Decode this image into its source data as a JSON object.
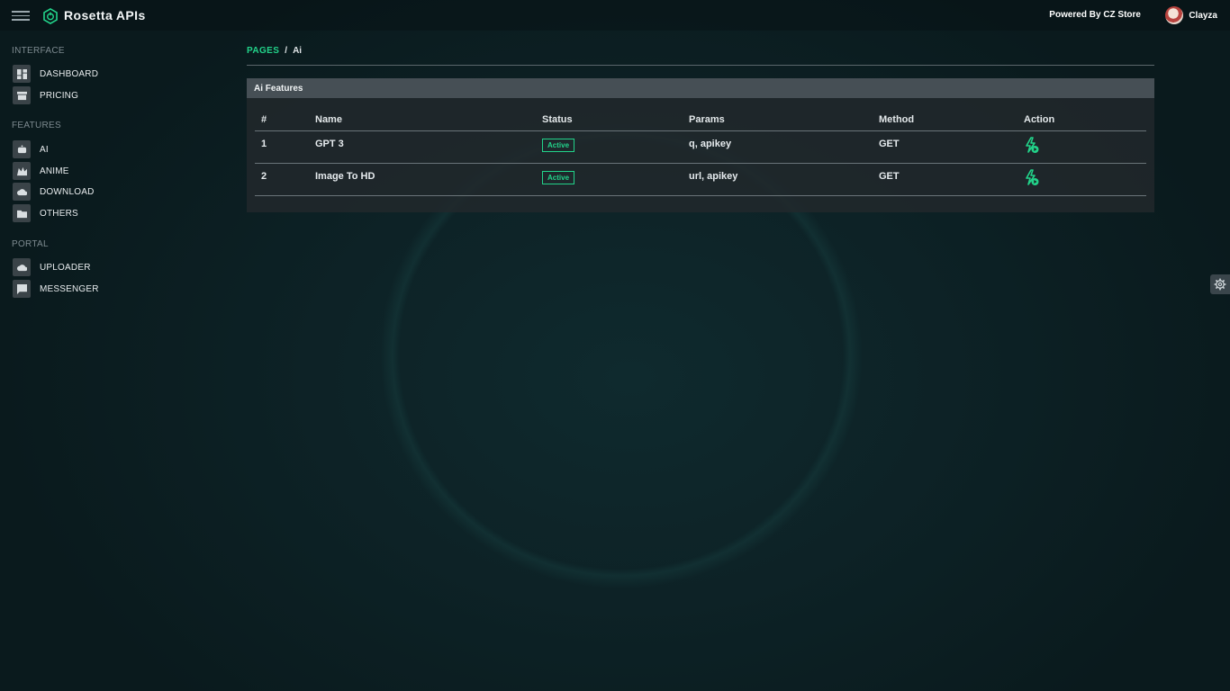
{
  "header": {
    "brand_title": "Rosetta APIs",
    "powered_by": "Powered By CZ Store",
    "user_name": "Clayza",
    "accent_color": "#22d38a"
  },
  "sidebar": {
    "sections": [
      {
        "title": "INTERFACE",
        "items": [
          {
            "label": "DASHBOARD",
            "icon": "dashboard-icon"
          },
          {
            "label": "PRICING",
            "icon": "store-icon"
          }
        ]
      },
      {
        "title": "FEATURES",
        "items": [
          {
            "label": "AI",
            "icon": "robot-icon"
          },
          {
            "label": "ANIME",
            "icon": "anime-icon"
          },
          {
            "label": "DOWNLOAD",
            "icon": "cloud-download-icon"
          },
          {
            "label": "OTHERS",
            "icon": "folder-icon"
          }
        ]
      },
      {
        "title": "PORTAL",
        "items": [
          {
            "label": "UPLOADER",
            "icon": "cloud-upload-icon"
          },
          {
            "label": "MESSENGER",
            "icon": "chat-icon"
          }
        ]
      }
    ]
  },
  "breadcrumb": {
    "parent": "PAGES",
    "separator": "/",
    "current": "Ai"
  },
  "card": {
    "title": "Ai Features",
    "columns": [
      "#",
      "Name",
      "Status",
      "Params",
      "Method",
      "Action"
    ],
    "rows": [
      {
        "num": "1",
        "name": "GPT 3",
        "status": "Active",
        "params": "q, apikey",
        "method": "GET",
        "action_icon": "run-api-icon"
      },
      {
        "num": "2",
        "name": "Image To HD",
        "status": "Active",
        "params": "url, apikey",
        "method": "GET",
        "action_icon": "run-api-icon"
      }
    ]
  }
}
